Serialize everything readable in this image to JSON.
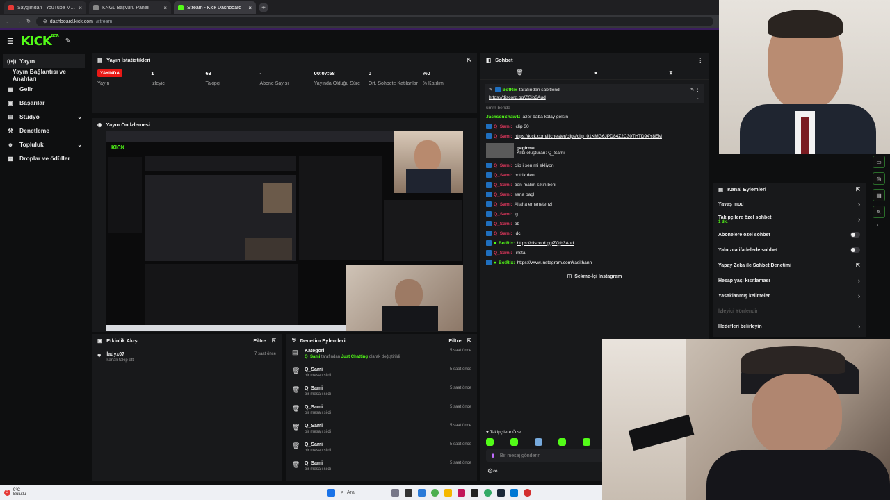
{
  "browser": {
    "tabs": [
      {
        "label": "Saygımdan | YouTube Music",
        "color": "#e53935",
        "active": false
      },
      {
        "label": "KNGL Başvuru Paneli",
        "color": "#888888",
        "active": false
      },
      {
        "label": "Stream - Kick Dashboard",
        "color": "#53fc18",
        "active": true
      }
    ],
    "url_host": "dashboard.kick.com",
    "url_path": "/stream"
  },
  "logo": {
    "text": "KICK",
    "sup": "BETA"
  },
  "sidebar": {
    "items": [
      {
        "label": "Yayın",
        "icon": "broadcast-icon",
        "glyph": "((•))",
        "active": true
      },
      {
        "label": "Yayın Bağlantısı ve Anahtarı",
        "icon": "",
        "glyph": "",
        "active": false
      },
      {
        "label": "Gelir",
        "icon": "revenue-icon",
        "glyph": "▦",
        "active": false
      },
      {
        "label": "Başarılar",
        "icon": "trophy-icon",
        "glyph": "▣",
        "active": false
      },
      {
        "label": "Stüdyo",
        "icon": "studio-icon",
        "glyph": "▤",
        "active": false,
        "chevron": true
      },
      {
        "label": "Denetleme",
        "icon": "hammer-icon",
        "glyph": "⚒",
        "active": false
      },
      {
        "label": "Topluluk",
        "icon": "community-icon",
        "glyph": "☻",
        "active": false,
        "chevron": true
      },
      {
        "label": "Droplar ve ödüller",
        "icon": "gift-icon",
        "glyph": "▩",
        "active": false
      }
    ]
  },
  "stats_panel": {
    "title": "Yayın İstatistikleri",
    "status_badge": "YAYINDA",
    "status_label": "Yayın",
    "stats": [
      {
        "value": "1",
        "label": "İzleyici"
      },
      {
        "value": "63",
        "label": "Takipçi"
      },
      {
        "value": "-",
        "label": "Abone Sayısı"
      },
      {
        "value": "00:07:58",
        "label": "Yayında Olduğu Süre"
      },
      {
        "value": "0",
        "label": "Ort. Sohbete Katılanlar"
      },
      {
        "value": "%0",
        "label": "% Katılım"
      }
    ]
  },
  "preview_panel": {
    "title": "Yayın Ön İzlemesi"
  },
  "activity_panel": {
    "title": "Etkinlik Akışı",
    "filter": "Filtre",
    "events": [
      {
        "user": "ladyx07",
        "text": "kanalı takip etti",
        "time": "7 saat önce"
      }
    ]
  },
  "mod_panel": {
    "title": "Denetim Eylemleri",
    "filter": "Filtre",
    "first": {
      "title": "Kategori",
      "user": "Q_Sami",
      "mid": "tarafından",
      "category": "Just Chatting",
      "end": "olarak değiştirildi",
      "time": "5 saat önce"
    },
    "rows": [
      {
        "user": "Q_Sami",
        "text": "bir mesajı sildi",
        "time": "5 saat önce"
      },
      {
        "user": "Q_Sami",
        "text": "bir mesajı sildi",
        "time": "5 saat önce"
      },
      {
        "user": "Q_Sami",
        "text": "bir mesajı sildi",
        "time": "5 saat önce"
      },
      {
        "user": "Q_Sami",
        "text": "bir mesajı sildi",
        "time": "5 saat önce"
      },
      {
        "user": "Q_Sami",
        "text": "bir mesajı sildi",
        "time": "5 saat önce"
      },
      {
        "user": "Q_Sami",
        "text": "bir mesajı sildi",
        "time": "5 saat önce"
      }
    ]
  },
  "chat": {
    "title": "Sohbet",
    "pinned": {
      "user": "BotRix",
      "suffix": "tarafından sabitlendi",
      "link": "https://discord.gg/ZQjb3Aud"
    },
    "partial_line": "ümm bende",
    "messages": [
      {
        "user": "JacksonShaw1:",
        "text": "azer baba kolay gelsin",
        "type": "green"
      },
      {
        "user": "Q_Sami:",
        "text": "!clip 30",
        "type": "red"
      },
      {
        "user": "Q_Sami:",
        "text": "https://kick.com/lilchester/clips/clip_01KMG6JPD84Z2C30THTD94Y8EM",
        "type": "red",
        "link": true
      },
      {
        "user": "Q_Sami:",
        "text": "clip i sen mi ekliyon",
        "type": "red"
      },
      {
        "user": "Q_Sami:",
        "text": "botrix den",
        "type": "red"
      },
      {
        "user": "Q_Sami:",
        "text": "ben malım sikin beni",
        "type": "red"
      },
      {
        "user": "Q_Sami:",
        "text": "sana baglı",
        "type": "red"
      },
      {
        "user": "Q_Sami:",
        "text": "Allaha emanetenzi",
        "type": "red"
      },
      {
        "user": "Q_Sami:",
        "text": "ig",
        "type": "red"
      },
      {
        "user": "Q_Sami:",
        "text": "bb",
        "type": "red"
      },
      {
        "user": "Q_Sami:",
        "text": "!dc",
        "type": "red"
      },
      {
        "user": "BotRix:",
        "text": "https://discord.gg/ZQjb3Aud",
        "type": "green",
        "link": true
      },
      {
        "user": "Q_Sami:",
        "text": "!insta",
        "type": "red"
      },
      {
        "user": "BotRix:",
        "text": "https://www.instagram.com/rasithann",
        "type": "green",
        "link": true
      }
    ],
    "clip": {
      "title": "gegirme",
      "sub": "Klibi oluşturan: Q_Sami"
    },
    "instagram_button": "Sekme-İçi Instagram",
    "followers_only": "Takipçilere Özel",
    "input_placeholder": "Bir mesaj gönderin"
  },
  "channel_actions": {
    "title": "Kanal Eylemleri",
    "items": [
      {
        "label": "Yavaş mod",
        "control": "arrow"
      },
      {
        "label": "Takipçilere özel sohbet",
        "sub": "1 dk.",
        "control": "arrow"
      },
      {
        "label": "Abonelere özel sohbet",
        "control": "toggle"
      },
      {
        "label": "Yalnızca ifadelerle sohbet",
        "control": "toggle"
      },
      {
        "label": "Yapay Zeka ile Sohbet Denetimi",
        "control": "external"
      },
      {
        "label": "Hesap yaşı kısıtlaması",
        "control": "arrow"
      },
      {
        "label": "Yasaklanmış kelimeler",
        "control": "arrow"
      },
      {
        "label": "İzleyici Yönlendir",
        "control": "none",
        "disabled": true
      },
      {
        "label": "Hedefleri belirleyin",
        "control": "arrow"
      }
    ]
  },
  "taskbar": {
    "weather_temp": "9°C",
    "weather_text": "Bulutlu",
    "search": "Ara",
    "notification_count": "2"
  },
  "colors": {
    "accent": "#53fc18",
    "live": "#e91916",
    "bg": "#0e0f10",
    "panel": "#18191b"
  }
}
